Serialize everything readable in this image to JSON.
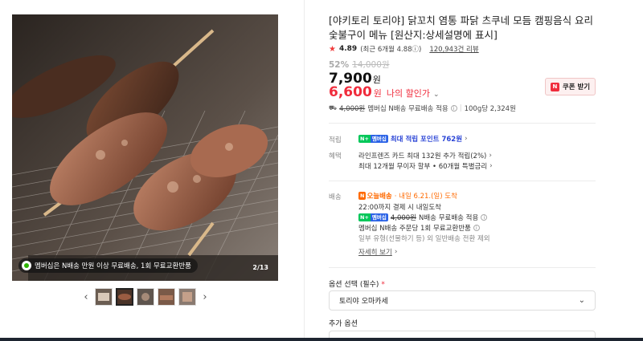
{
  "gallery": {
    "promo_text": "멤버십은 N배송 만원 이상 무료배송, 1회 무료교환반품",
    "counter": "2/13",
    "prev_arrow": "‹",
    "next_arrow": "›",
    "thumb_count": 5,
    "active_thumb": 2
  },
  "product": {
    "title": "[야키토리 토리야] 닭꼬치 염통 파닭 츠쿠네 모듬 캠핑음식 요리 숯불구이 메뉴 [원산지:상세설명에 표시]",
    "rating": "4.89",
    "rating_detail": "(최근 6개월 4.88ⓘ)",
    "review_count": "120,943건 리뷰",
    "discount_rate": "52%",
    "original_price": "14,000원",
    "price": "7,900",
    "price_unit": "원",
    "my_price": "6,600",
    "my_price_unit": "원",
    "my_price_label": "나의 할인가",
    "coupon_label": "쿠폰 받기",
    "shipping": {
      "fee_strike": "4,000원",
      "fee_text": "멤버십 N배송 무료배송 적용",
      "per_unit": "100g당 2,324원"
    }
  },
  "benefits": {
    "points_label": "적립",
    "points_badge_n": "N+",
    "points_badge_m": "멤버십",
    "points_text": "최대 적립 포인트 762원",
    "perk_label": "혜택",
    "perk_line1": "라인프렌즈 카드 최대 132원 추가 적립(2%)",
    "perk_line2": "최대 12개월 무이자 할부 • 60개월 특별금리"
  },
  "delivery": {
    "label": "배송",
    "badge": "N",
    "badge_text": "오늘배송",
    "arrival": "· 내일 6.21.(일) 도착",
    "deadline": "22:00까지 결제 시 내일도착",
    "member_fee_strike": "4,000원",
    "member_fee_text": "N배송 무료배송 적용",
    "return_text": "멤버십 N배송 주문당 1회 무료교환반품",
    "exclude_text": "일부 유형(선물하기 등) 외 일반배송 전환 제외",
    "detail_link": "자세히 보기"
  },
  "options": {
    "required_label": "옵션 선택 (필수)",
    "required_mark": "*",
    "selected": "토리야 오마카세",
    "additional_label": "추가 옵션"
  },
  "colors": {
    "accent_red": "#f02c3c",
    "naver_green": "#03c75a",
    "membership_blue": "#2a44d6",
    "delivery_orange": "#ff6a00"
  }
}
